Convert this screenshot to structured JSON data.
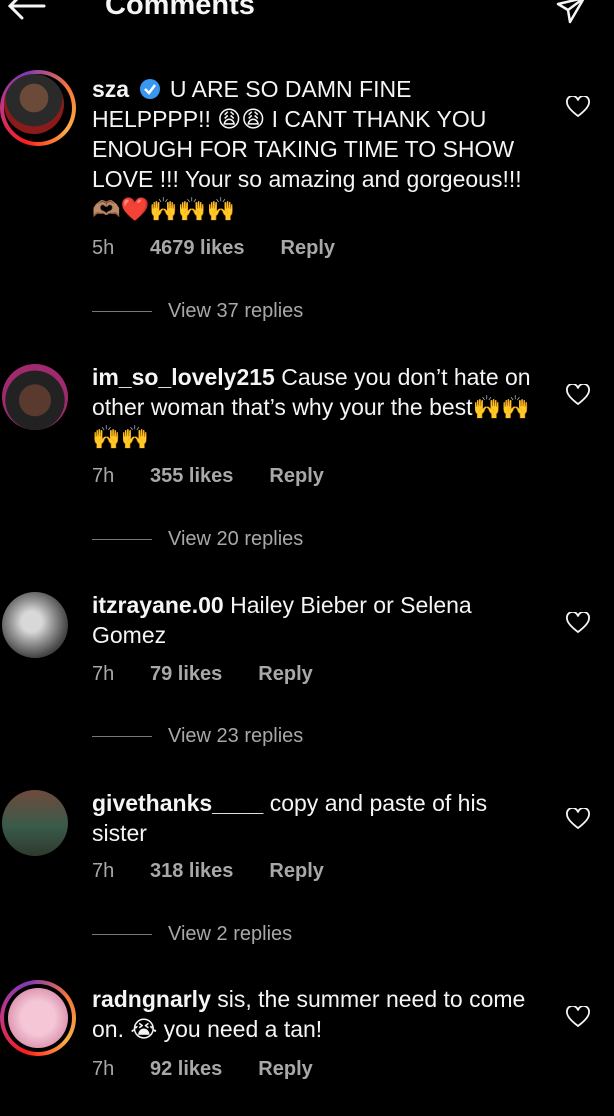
{
  "header": {
    "title": "Comments",
    "back_icon": "back-arrow-icon",
    "send_icon": "send-icon"
  },
  "comments": [
    {
      "username": "sza",
      "verified": true,
      "text": "U ARE SO DAMN FINE HELPPPP!! 😩😩 I CANT THANK YOU ENOUGH FOR TAKING TIME TO SHOW LOVE !!! Your so amazing and gorgeous!!!🫶🏽❤️🙌🙌🙌",
      "time": "5h",
      "likes": "4679 likes",
      "reply_label": "Reply",
      "view_replies": "View 37 replies"
    },
    {
      "username": "im_so_lovely215",
      "text": "Cause you don’t hate on other woman that’s why your the best🙌🙌🙌🙌",
      "time": "7h",
      "likes": "355 likes",
      "reply_label": "Reply",
      "view_replies": "View 20 replies"
    },
    {
      "username": "itzrayane.00",
      "text": "Hailey Bieber or Selena Gomez",
      "time": "7h",
      "likes": "79 likes",
      "reply_label": "Reply",
      "view_replies": "View 23 replies"
    },
    {
      "username": "givethanks____",
      "text": "copy and paste of his sister",
      "time": "7h",
      "likes": "318 likes",
      "reply_label": "Reply",
      "view_replies": "View 2 replies"
    },
    {
      "username": "radngnarly",
      "text": "sis, the summer need to come on. 😭 you need a tan!",
      "time": "7h",
      "likes": "92 likes",
      "reply_label": "Reply"
    }
  ],
  "colors": {
    "background": "#000000",
    "text": "#f5f5f5",
    "muted": "#a8a8a8",
    "verified": "#3897f0"
  }
}
